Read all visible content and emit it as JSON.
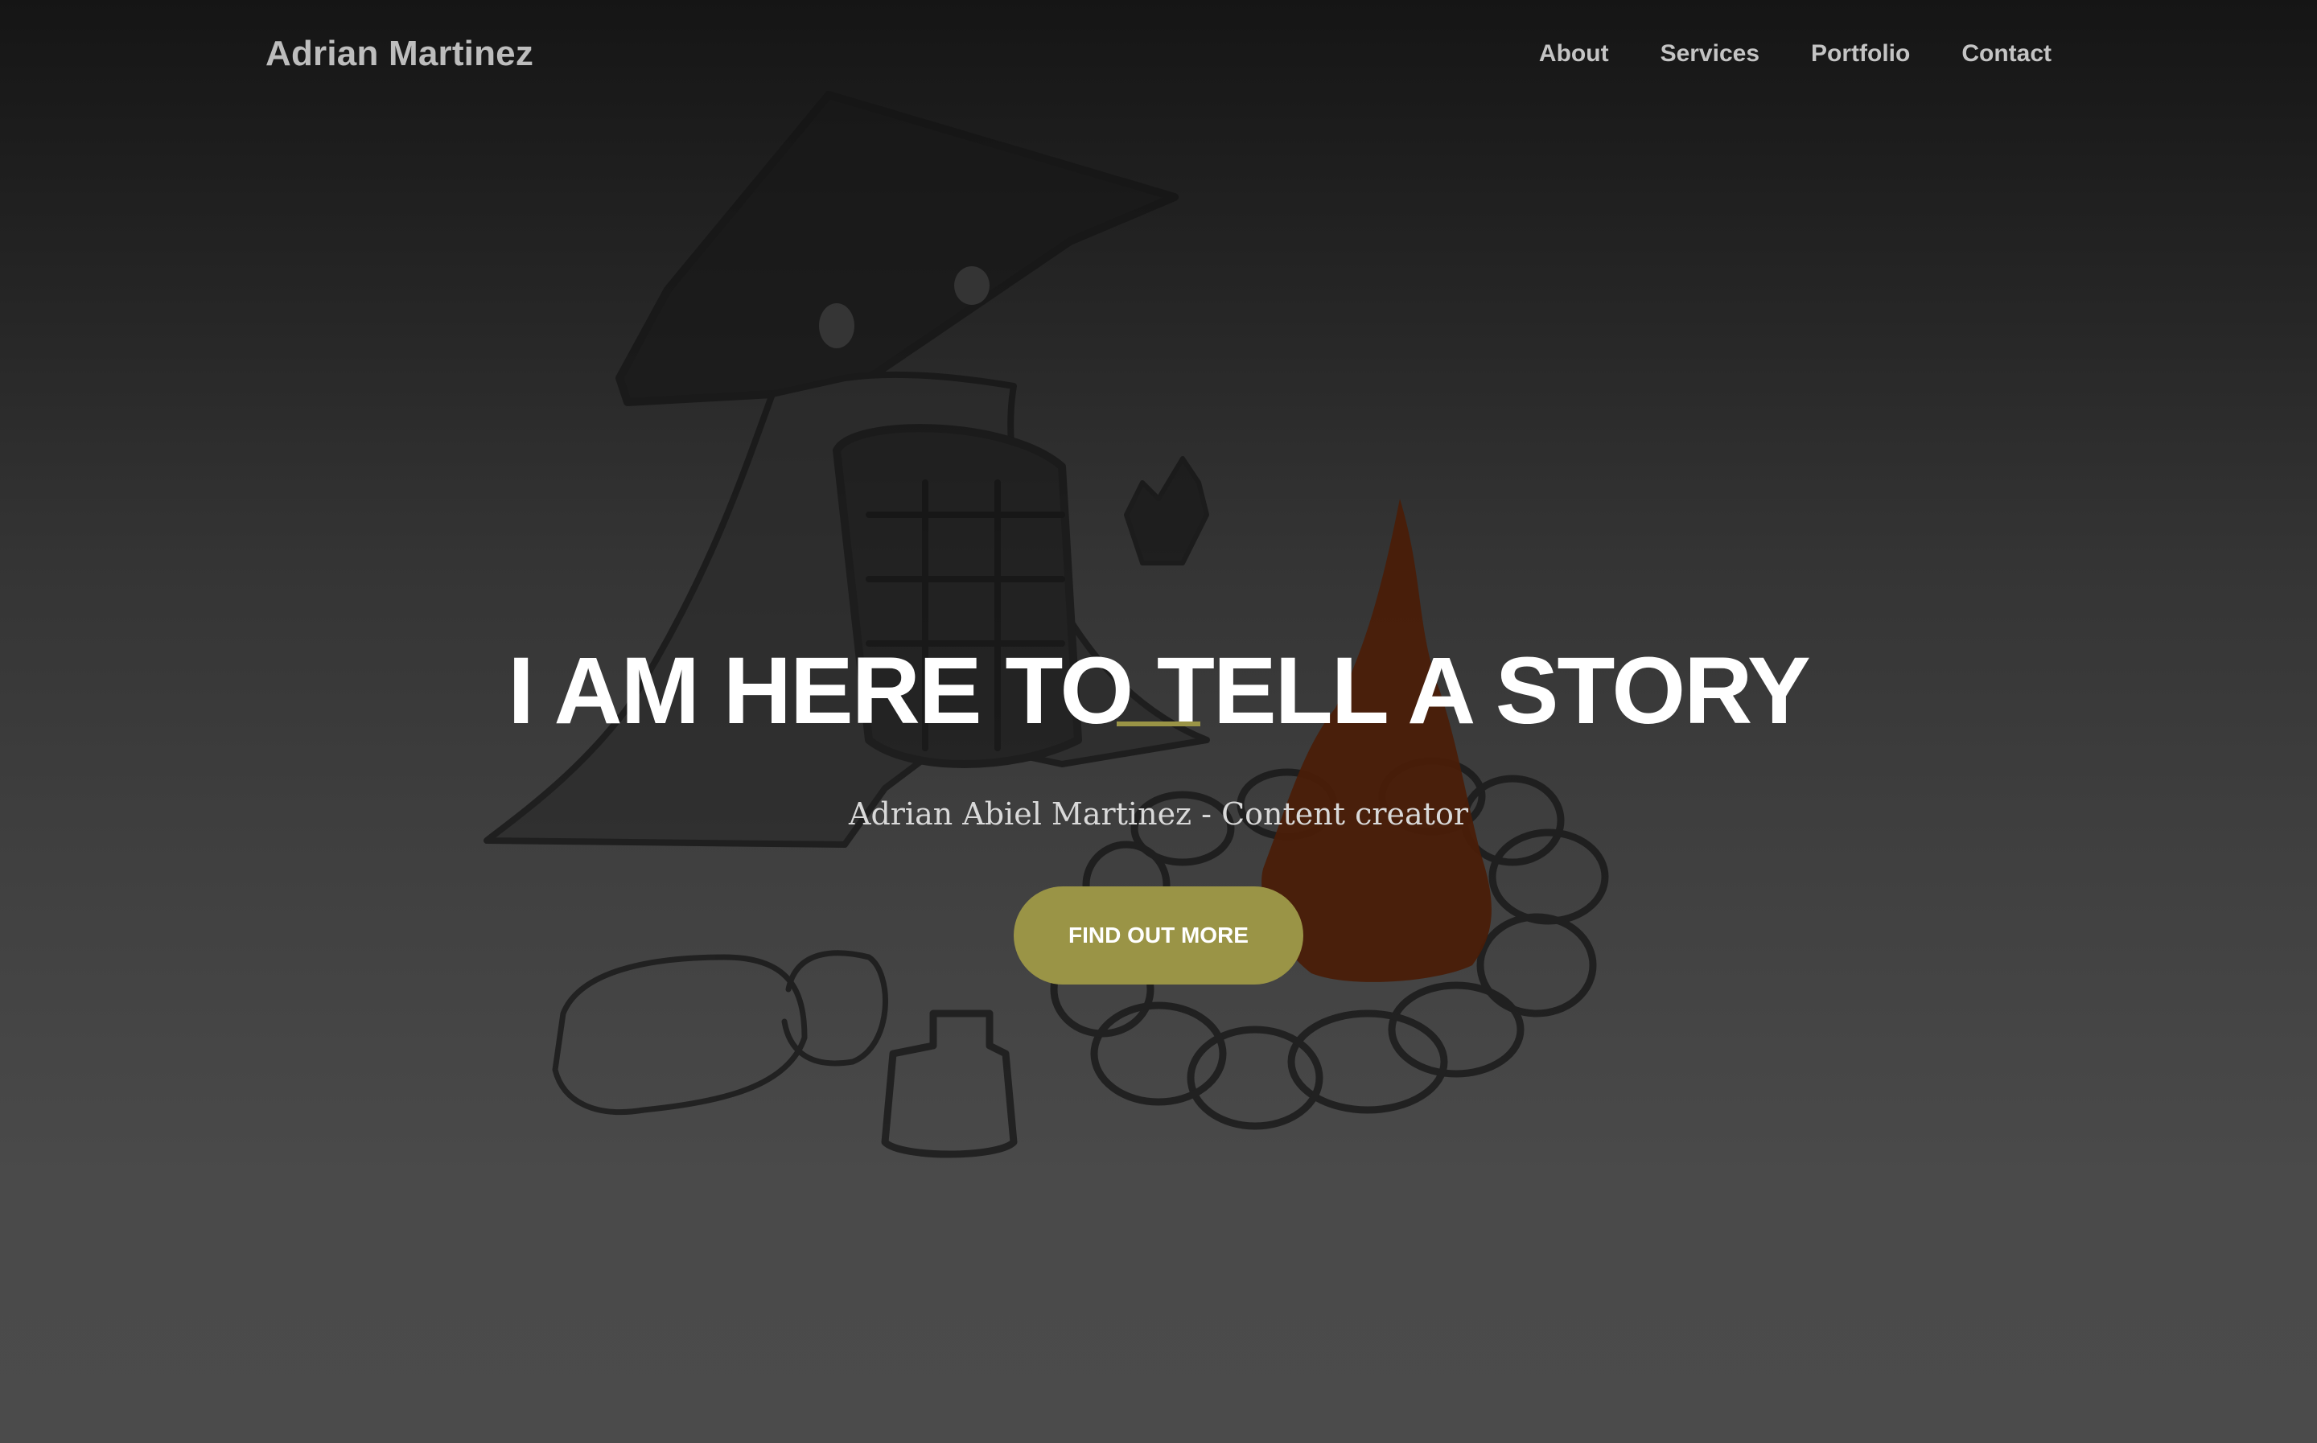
{
  "navbar": {
    "brand": "Adrian Martinez",
    "links": [
      {
        "label": "About"
      },
      {
        "label": "Services"
      },
      {
        "label": "Portfolio"
      },
      {
        "label": "Contact"
      }
    ]
  },
  "hero": {
    "headline": "I AM HERE TO TELL A STORY",
    "subtitle": "Adrian Abiel Martinez - Content creator",
    "cta_label": "FIND OUT MORE",
    "background_image": "campfire-sketch-illustration"
  },
  "colors": {
    "accent": "#9a9446",
    "fire": "#4a1d08",
    "background_top": "#151515",
    "background_bottom": "#4b4b4b"
  }
}
